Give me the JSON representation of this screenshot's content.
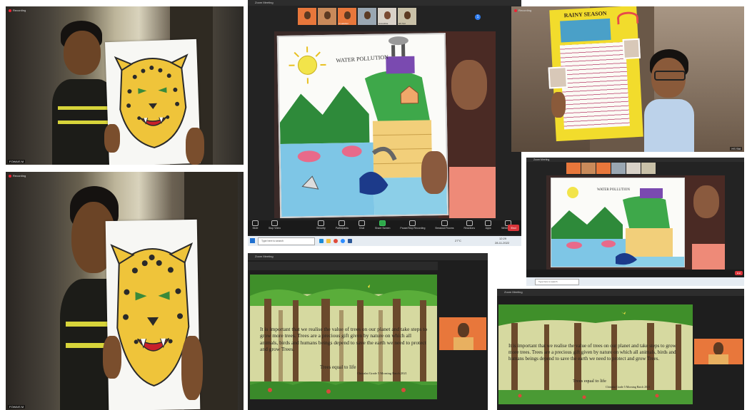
{
  "colors": {
    "zoom_bg": "#232323",
    "zoom_bar": "#1a1a1a",
    "end_red": "#d9353a",
    "orange_thumb": "#e8773b",
    "forest_green": "#3f8f2a",
    "poster_yellow": "#f2dc2c"
  },
  "tiles": {
    "top_left": {
      "rec_label": "Recording",
      "name_tag": "FOWAIS M"
    },
    "bottom_left": {
      "rec_label": "Recording",
      "name_tag": "FOWAIS M"
    },
    "top_right": {
      "rec_label": "Recording",
      "name_tag": "HS Std"
    }
  },
  "zoom_main": {
    "window_title": "Zoom Meeting",
    "thumbnails": [
      "",
      "",
      " A Lakshmi",
      "",
      "Anoushka",
      "HS Std"
    ],
    "thumb_badge": "1",
    "drawing_title": "WATER POLLUTION",
    "controls": [
      {
        "label": "Mute",
        "icon": "microphone-icon"
      },
      {
        "label": "Stop Video",
        "icon": "video-camera-icon"
      },
      {
        "label": "Security",
        "icon": "shield-icon"
      },
      {
        "label": "Participants",
        "icon": "people-icon"
      },
      {
        "label": "Chat",
        "icon": "chat-icon"
      },
      {
        "label": "Share Screen",
        "icon": "share-screen-icon"
      },
      {
        "label": "Pause/Stop Recording",
        "icon": "record-icon"
      },
      {
        "label": "Breakout Rooms",
        "icon": "rooms-icon"
      },
      {
        "label": "Reactions",
        "icon": "smile-icon"
      },
      {
        "label": "Apps",
        "icon": "apps-icon"
      },
      {
        "label": "Whiteboards",
        "icon": "whiteboard-icon"
      }
    ],
    "end_label": "End",
    "search_placeholder": "Type here to search",
    "clock_time": "12:29",
    "clock_date": "28-11-2022",
    "tray_temp": "27°C"
  },
  "zoom_small": {
    "window_title": "Zoom Meeting",
    "drawing_title": "WATER POLLUTION",
    "end_label": "End",
    "search_placeholder": "Type here to search"
  },
  "poster": {
    "title": "RAINY SEASON"
  },
  "slide_left": {
    "window_title": "Zoom Meeting",
    "body": "It is important that we realise the value of trees on our planet and take steps to grow more trees. Trees are a precious gift given by nature on which all animals, birds and humans beings depend to save the earth we need to protect and grow Trees.",
    "footer": "Trees equal to life",
    "credit": "Chitralai Grade 5 Morning Batch 2021"
  },
  "slide_right": {
    "window_title": "Zoom Meeting",
    "body": "It is important that we realise the value of trees on our planet and take steps to grow more trees. Trees are a precious gift given by nature on which all animals, birds and humans beings depend to save the earth we need to protect and grow Trees.",
    "footer": "Trees equal to life",
    "credit": "Chitralai Grade 5 Morning Batch 2021"
  }
}
